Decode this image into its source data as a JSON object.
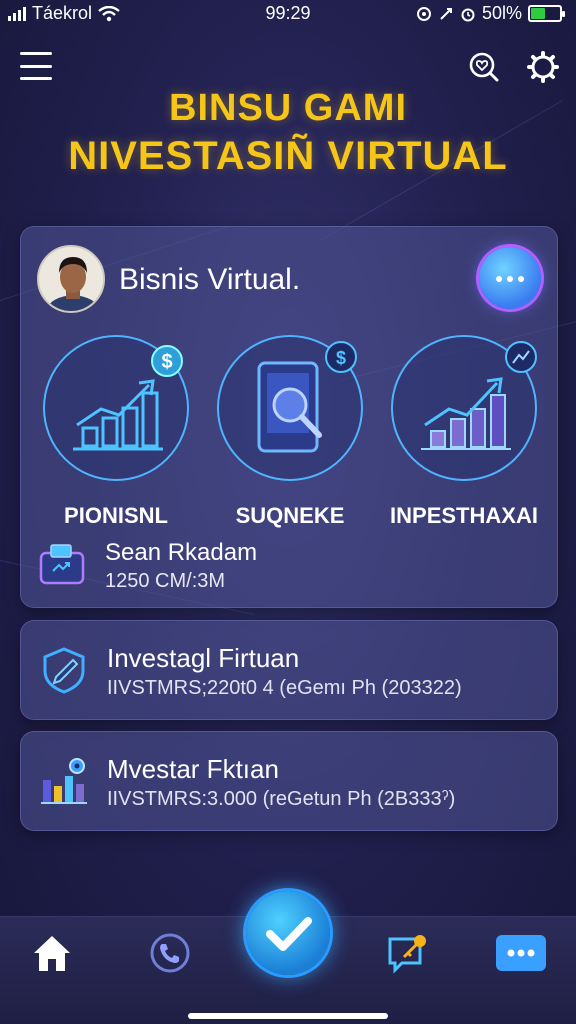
{
  "status_bar": {
    "carrier": "Táekrol",
    "time": "99:29",
    "battery": "50l%",
    "battery_level": 0.5
  },
  "header": {
    "menu_icon": "hamburger-menu-icon",
    "search_icon": "heart-search-icon",
    "settings_icon": "gear-icon"
  },
  "title": {
    "line1": "BINSU GAMI",
    "line2": "NIVESTASIÑ VIRTUAL"
  },
  "main_card": {
    "title": "Bisnis Virtual.",
    "chat_icon": "chat-dots-icon",
    "features": [
      {
        "label": "PIONISNL",
        "icon": "growth-chart-dollar-icon"
      },
      {
        "label": "SUQNEKE",
        "icon": "tablet-search-icon"
      },
      {
        "label": "INPESTHAXAI",
        "icon": "bar-chart-trend-icon"
      }
    ],
    "summary": {
      "name": "Sean Rkadam",
      "value": "1250 CM/:3M",
      "icon": "wallet-icon"
    }
  },
  "investments": [
    {
      "name": "Investagl Firtuan",
      "detail": "IIVSTMRS;220t0 4  (eGemı Ph  (203322)",
      "icon": "shield-pen-icon"
    },
    {
      "name": "Mvestar Fktıan",
      "detail": "IIVSTMRS:3.000  (reGetun Ph  (2B333ˀ)",
      "icon": "bar-chart-gear-icon"
    }
  ],
  "bottom_nav": [
    {
      "name": "home",
      "icon": "home-icon"
    },
    {
      "name": "call",
      "icon": "phone-icon"
    },
    {
      "name": "confirm",
      "icon": "checkmark-icon"
    },
    {
      "name": "messages",
      "icon": "chat-key-icon"
    },
    {
      "name": "more",
      "icon": "more-dots-icon"
    }
  ],
  "colors": {
    "title": "#f5c518",
    "accent": "#3aa0ff",
    "background": "#222150"
  }
}
